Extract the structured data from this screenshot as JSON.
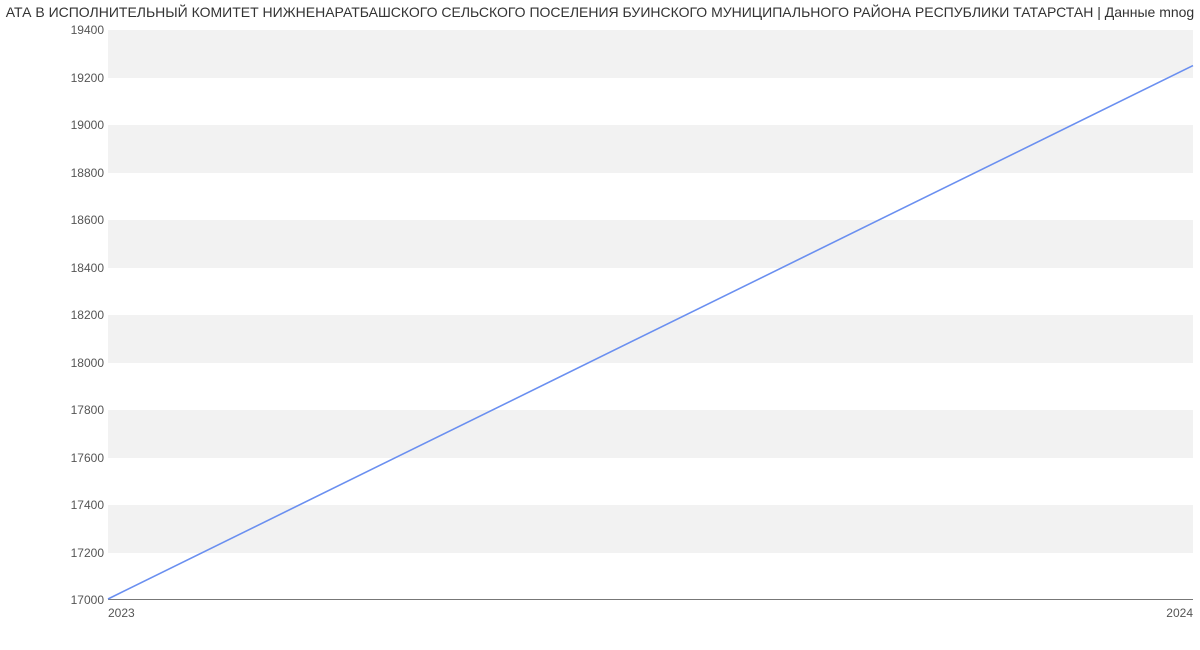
{
  "chart_data": {
    "type": "line",
    "title": "АТА В ИСПОЛНИТЕЛЬНЫЙ КОМИТЕТ НИЖНЕНАРАТБАШСКОГО СЕЛЬСКОГО ПОСЕЛЕНИЯ БУИНСКОГО МУНИЦИПАЛЬНОГО РАЙОНА РЕСПУБЛИКИ ТАТАРСТАН | Данные mnog",
    "xlabel": "",
    "ylabel": "",
    "x": [
      2023,
      2024
    ],
    "values": [
      17000,
      19250
    ],
    "categories": [
      "2023",
      "2024"
    ],
    "xlim": [
      2023,
      2024
    ],
    "ylim": [
      17000,
      19400
    ],
    "yticks": [
      17000,
      17200,
      17400,
      17600,
      17800,
      18000,
      18200,
      18400,
      18600,
      18800,
      19000,
      19200,
      19400
    ],
    "series": [
      {
        "name": "",
        "values": [
          17000,
          19250
        ]
      }
    ]
  }
}
